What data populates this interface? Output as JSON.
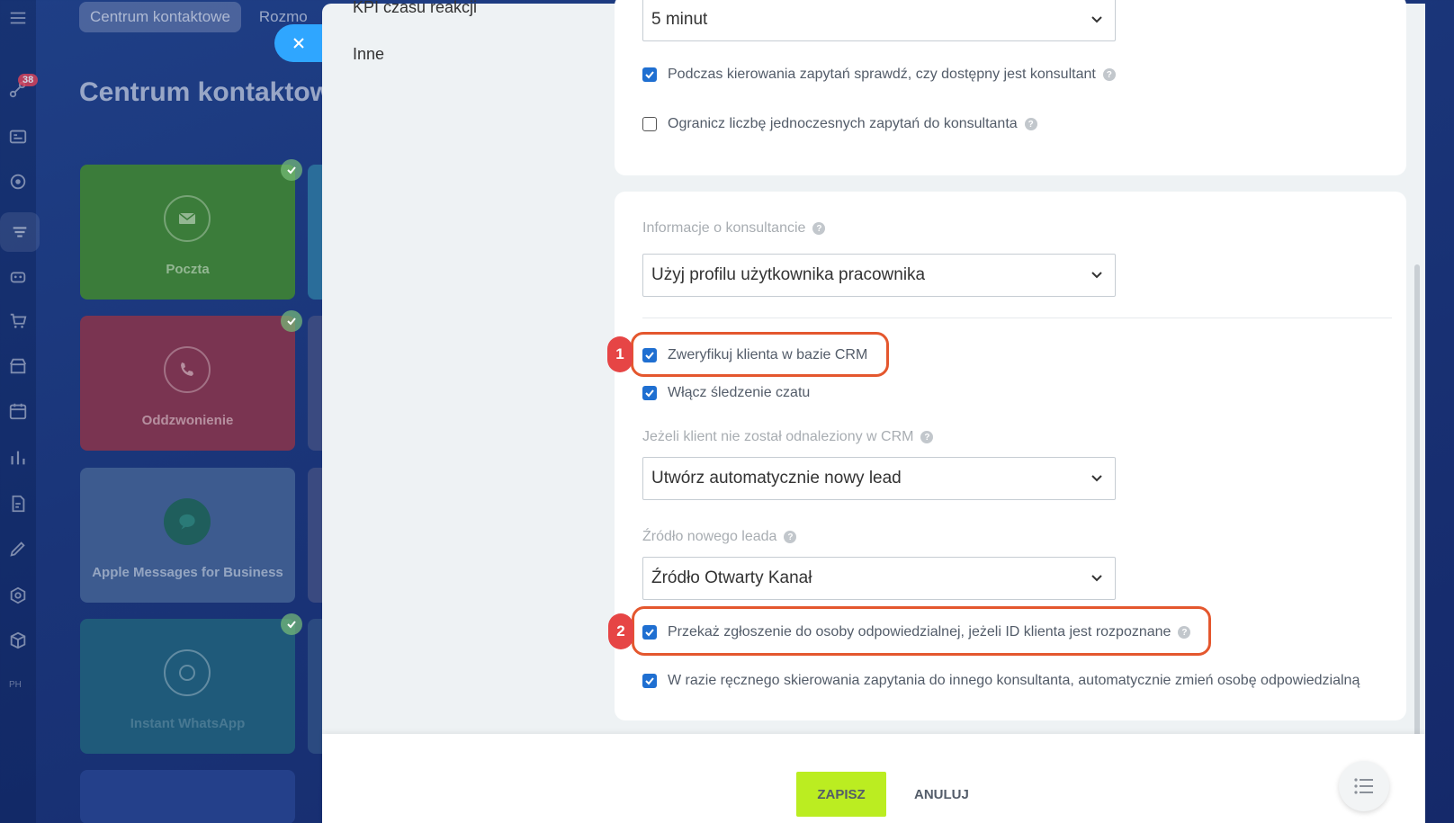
{
  "rail": {
    "badge": "38",
    "text_item": "PH"
  },
  "background": {
    "tabs": [
      "Centrum kontaktowe",
      "Rozmo"
    ],
    "title": "Centrum kontaktow",
    "tiles": [
      "Poczta",
      "Oddzwonienie",
      "Apple Messages for Business",
      "Instant WhatsApp"
    ]
  },
  "nav": {
    "items": [
      "KPI czasu reakcji",
      "Inne"
    ]
  },
  "card1": {
    "time_select": "5 minut",
    "checkbox_check_consultant": "Podczas kierowania zapytań sprawdź, czy dostępny jest konsultant",
    "checkbox_limit_requests": "Ogranicz liczbę jednoczesnych zapytań do konsultanta"
  },
  "card2": {
    "consultant_info_label": "Informacje o konsultancie",
    "consultant_info_select": "Użyj profilu użytkownika pracownika",
    "checkbox_verify_crm": "Zweryfikuj klienta w bazie CRM",
    "checkbox_chat_tracking": "Włącz śledzenie czatu",
    "not_found_label": "Jeżeli klient nie został odnaleziony w CRM",
    "not_found_select": "Utwórz automatycznie nowy lead",
    "lead_source_label": "Źródło nowego leada",
    "lead_source_select": "Źródło Otwarty Kanał",
    "checkbox_forward_responsible": "Przekaż zgłoszenie do osoby odpowiedzialnej, jeżeli ID klienta jest rozpoznane",
    "checkbox_change_responsible": "W razie ręcznego skierowania zapytania do innego konsultanta, automatycznie zmień osobę odpowiedzialną"
  },
  "annotations": [
    "1",
    "2"
  ],
  "footer": {
    "save": "ZAPISZ",
    "cancel": "ANULUJ"
  },
  "icons": {
    "help": "?"
  },
  "colors": {
    "accent_blue": "#2fa6ff",
    "checkbox_blue": "#1f6fd1",
    "save_green": "#bbed21",
    "annotation_red": "#e4572e"
  }
}
